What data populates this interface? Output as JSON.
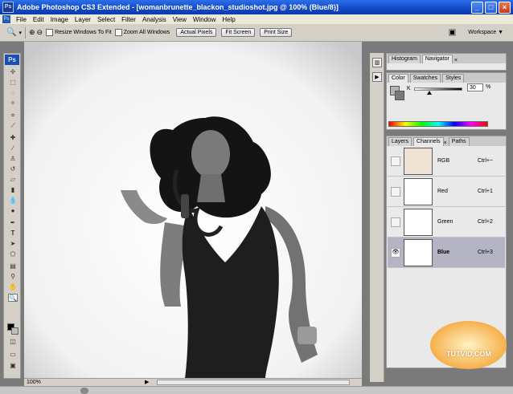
{
  "window": {
    "title": "Adobe Photoshop CS3 Extended - [womanbrunette_blackon_studioshot.jpg @ 100% (Blue/8)]",
    "app_icon": "Ps"
  },
  "menu": [
    "File",
    "Edit",
    "Image",
    "Layer",
    "Select",
    "Filter",
    "Analysis",
    "View",
    "Window",
    "Help"
  ],
  "options": {
    "resize_windows": "Resize Windows To Fit",
    "zoom_all_windows": "Zoom All Windows",
    "actual_pixels": "Actual Pixels",
    "fit_screen": "Fit Screen",
    "print_size": "Print Size",
    "workspace": "Workspace ▼"
  },
  "toolbox": {
    "logo": "Ps"
  },
  "document": {
    "zoom": "100%"
  },
  "nav_panel": {
    "tabs": [
      "Histogram",
      "Navigator"
    ]
  },
  "color_panel": {
    "tabs": [
      "Color",
      "Swatches",
      "Styles"
    ],
    "channel_label": "K",
    "value": "30",
    "unit": "%"
  },
  "channels_panel": {
    "tabs": [
      "Layers",
      "Channels",
      "Paths"
    ],
    "rows": [
      {
        "name": "RGB",
        "shortcut": "Ctrl+~"
      },
      {
        "name": "Red",
        "shortcut": "Ctrl+1"
      },
      {
        "name": "Green",
        "shortcut": "Ctrl+2"
      },
      {
        "name": "Blue",
        "shortcut": "Ctrl+3"
      }
    ]
  },
  "watermark": "TUTVID.COM"
}
